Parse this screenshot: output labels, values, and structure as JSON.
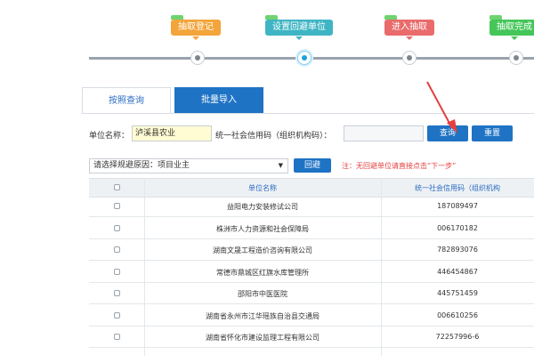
{
  "steps": [
    {
      "label": "抽取登记",
      "color": "#f3a43a"
    },
    {
      "label": "设置回避单位",
      "color": "#3fb5c4"
    },
    {
      "label": "进入抽取",
      "color": "#e96b6b"
    },
    {
      "label": "抽取完成",
      "color": "#44c659"
    }
  ],
  "tabs": {
    "tab1": "按照查询",
    "tab2": "批量导入"
  },
  "search": {
    "unit_label": "单位名称：",
    "unit_value": "泸溪县农业",
    "code_label": "统一社会信用码（组织机构码）：",
    "code_value": "",
    "query_button": "查询",
    "reset_button": "重置"
  },
  "filter": {
    "label": "请选择规避原因：",
    "selected": "项目业主",
    "avoid_button": "回避",
    "note": "注：无回避单位请直接点击“下一步”"
  },
  "table": {
    "headers": {
      "name": "单位名称",
      "code": "统一社会信用码（组织机构"
    },
    "rows": [
      {
        "name": "益阳电力安装修试公司",
        "code": "187089497"
      },
      {
        "name": "株洲市人力资源和社会保障局",
        "code": "006170182"
      },
      {
        "name": "湖南文晟工程造价咨询有限公司",
        "code": "782893076"
      },
      {
        "name": "常德市鼎城区红旗水库管理所",
        "code": "446454867"
      },
      {
        "name": "邵阳市中医医院",
        "code": "445751459"
      },
      {
        "name": "湖南省永州市江华瑶族自治县交通局",
        "code": "006610256"
      },
      {
        "name": "湖南省怀化市建设监理工程有限公司",
        "code": "72257996-6"
      }
    ]
  },
  "colors": {
    "accent": "#1f73c4",
    "note": "#e53f3f"
  }
}
